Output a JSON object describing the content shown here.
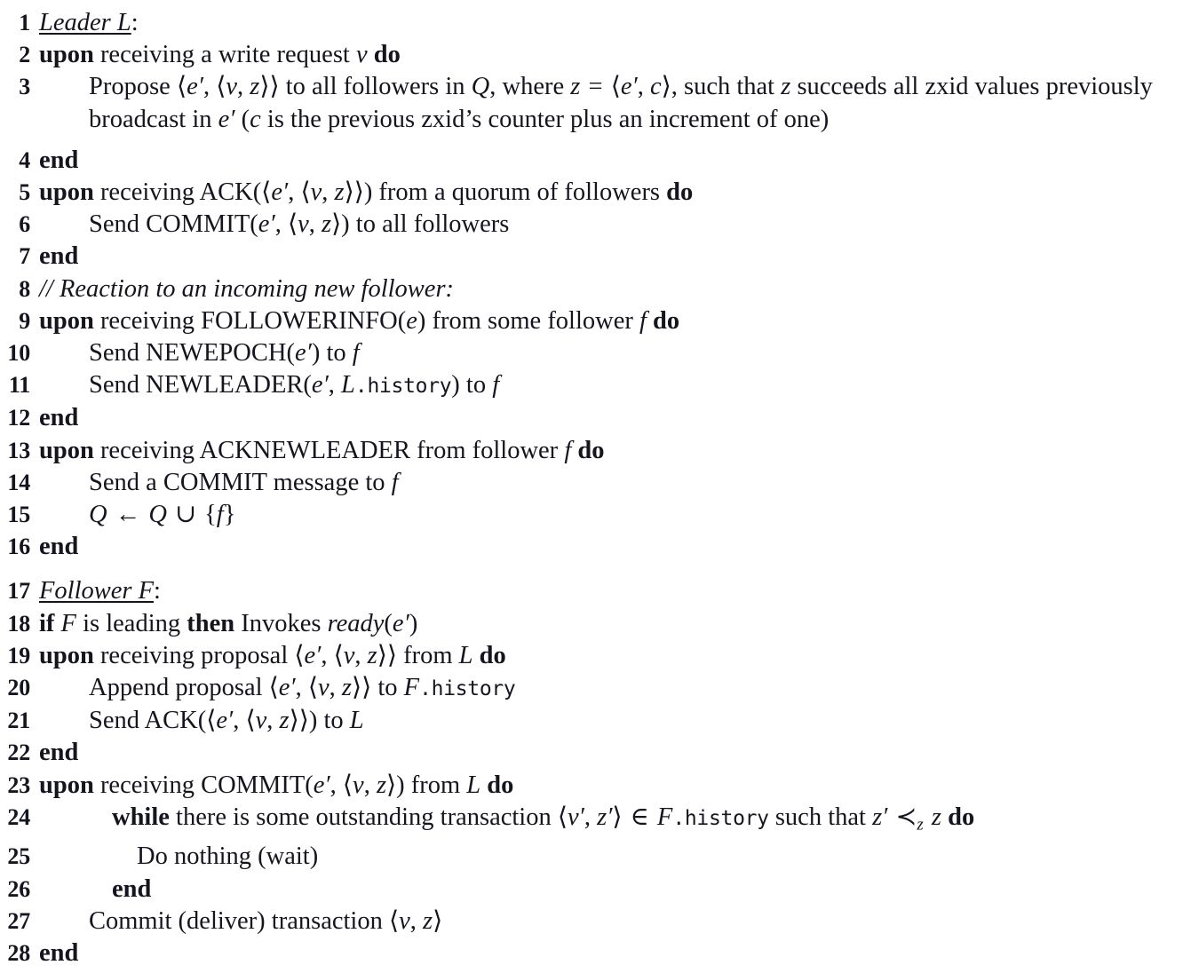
{
  "document": {
    "type": "algorithm-pseudocode",
    "title": "Zab broadcast phase pseudocode (Leader L and Follower F)",
    "font_note": "LaTeX Computer Modern style serif",
    "text_color": "#15151f",
    "background_color": "#ffffff"
  },
  "lines": [
    {
      "n": "1",
      "indent": 0,
      "html": "<span class=\"mi ul\">Leader L</span>:"
    },
    {
      "n": "2",
      "indent": 0,
      "html": "<span class=\"kw\">upon</span> receiving a write request <span class=\"mi\">v</span> <span class=\"kw\">do</span>"
    },
    {
      "n": "3",
      "indent": 1,
      "html": "Propose &#10216;<span class=\"mi\">e</span><span class=\"prime\">&#8242;</span>, &#10216;<span class=\"mi\">v</span>, <span class=\"mi\">z</span>&#10217;&#10217; to all followers in <span class=\"mi\">Q</span>, where <span class=\"mi\">z</span> <span class=\"op\">=</span> &#10216;<span class=\"mi\">e</span><span class=\"prime\">&#8242;</span>, <span class=\"mi\">c</span>&#10217;, such that <span class=\"mi\">z</span> succeeds all zxid values previously broadcast in <span class=\"mi\">e</span><span class=\"prime\">&#8242;</span> (<span class=\"mi\">c</span> is the previous zxid&#8217;s counter plus an increment of one)"
    },
    {
      "n": "4",
      "indent": 0,
      "html": "<span class=\"kw\">end</span>"
    },
    {
      "n": "5",
      "indent": 0,
      "html": "<span class=\"kw\">upon</span> receiving ACK(&#10216;<span class=\"mi\">e</span><span class=\"prime\">&#8242;</span>, &#10216;<span class=\"mi\">v</span>, <span class=\"mi\">z</span>&#10217;&#10217;) from a quorum of followers <span class=\"kw\">do</span>"
    },
    {
      "n": "6",
      "indent": 1,
      "html": "Send COMMIT(<span class=\"mi\">e</span><span class=\"prime\">&#8242;</span>, &#10216;<span class=\"mi\">v</span>, <span class=\"mi\">z</span>&#10217;) to all followers"
    },
    {
      "n": "7",
      "indent": 0,
      "html": "<span class=\"kw\">end</span>"
    },
    {
      "n": "8",
      "indent": 0,
      "html": "<span class=\"cmt\">// Reaction to an incoming new follower:</span>"
    },
    {
      "n": "9",
      "indent": 0,
      "html": "<span class=\"kw\">upon</span> receiving FOLLOWERINFO(<span class=\"mi\">e</span>) from some follower <span class=\"mi\">f</span> <span class=\"kw\">do</span>"
    },
    {
      "n": "10",
      "indent": 1,
      "html": "Send NEWEPOCH(<span class=\"mi\">e</span><span class=\"prime\">&#8242;</span>) to <span class=\"mi\">f</span>"
    },
    {
      "n": "11",
      "indent": 1,
      "html": "Send NEWLEADER(<span class=\"mi\">e</span><span class=\"prime\">&#8242;</span>, <span class=\"mi\">L</span><span class=\"tt\">.history</span>) to <span class=\"mi\">f</span>"
    },
    {
      "n": "12",
      "indent": 0,
      "html": "<span class=\"kw\">end</span>"
    },
    {
      "n": "13",
      "indent": 0,
      "html": "<span class=\"kw\">upon</span> receiving ACKNEWLEADER from follower <span class=\"mi\">f</span> <span class=\"kw\">do</span>"
    },
    {
      "n": "14",
      "indent": 1,
      "html": "Send a COMMIT message to <span class=\"mi\">f</span>"
    },
    {
      "n": "15",
      "indent": 1,
      "html": "<span class=\"mi\">Q</span> <span class=\"op\">&#8592;</span> <span class=\"mi\">Q</span> <span class=\"op\">&#8746;</span> {<span class=\"mi\">f</span>}"
    },
    {
      "n": "16",
      "indent": 0,
      "html": "<span class=\"kw\">end</span>"
    },
    {
      "n": "17",
      "indent": 0,
      "gap_before": true,
      "html": "<span class=\"mi ul\">Follower F</span>:"
    },
    {
      "n": "18",
      "indent": 0,
      "html": "<span class=\"kw\">if</span> <span class=\"mi\">F</span> is leading <span class=\"kw\">then</span> Invokes <span class=\"mi\">ready</span>(<span class=\"mi\">e</span><span class=\"prime\">&#8242;</span>)"
    },
    {
      "n": "19",
      "indent": 0,
      "html": "<span class=\"kw\">upon</span> receiving proposal &#10216;<span class=\"mi\">e</span><span class=\"prime\">&#8242;</span>, &#10216;<span class=\"mi\">v</span>, <span class=\"mi\">z</span>&#10217;&#10217; from <span class=\"mi\">L</span> <span class=\"kw\">do</span>"
    },
    {
      "n": "20",
      "indent": 1,
      "html": "Append proposal &#10216;<span class=\"mi\">e</span><span class=\"prime\">&#8242;</span>, &#10216;<span class=\"mi\">v</span>, <span class=\"mi\">z</span>&#10217;&#10217; to <span class=\"mi\">F</span><span class=\"tt\">.history</span>"
    },
    {
      "n": "21",
      "indent": 1,
      "html": "Send ACK(&#10216;<span class=\"mi\">e</span><span class=\"prime\">&#8242;</span>, &#10216;<span class=\"mi\">v</span>, <span class=\"mi\">z</span>&#10217;&#10217;) to <span class=\"mi\">L</span>"
    },
    {
      "n": "22",
      "indent": 0,
      "html": "<span class=\"kw\">end</span>"
    },
    {
      "n": "23",
      "indent": 0,
      "html": "<span class=\"kw\">upon</span> receiving COMMIT(<span class=\"mi\">e</span><span class=\"prime\">&#8242;</span>, &#10216;<span class=\"mi\">v</span>, <span class=\"mi\">z</span>&#10217;) from <span class=\"mi\">L</span> <span class=\"kw\">do</span>"
    },
    {
      "n": "24",
      "indent": 2,
      "html": "<span class=\"kw\">while</span> there is some outstanding transaction &#10216;<span class=\"mi\">v</span><span class=\"prime\">&#8242;</span>, <span class=\"mi\">z</span><span class=\"prime\">&#8242;</span>&#10217; <span class=\"op\">&#8712;</span> <span class=\"mi\">F</span><span class=\"tt\">.history</span> such that <span class=\"mi\">z</span><span class=\"prime\">&#8242;</span> <span class=\"op\">&#8826;<span class=\"sub\">z</span></span> <span class=\"mi\">z</span> <span class=\"kw\">do</span>"
    },
    {
      "n": "25",
      "indent": 3,
      "html": "Do nothing (wait)"
    },
    {
      "n": "26",
      "indent": 2,
      "html": "<span class=\"kw\">end</span>"
    },
    {
      "n": "27",
      "indent": 1,
      "html": "Commit (deliver) transaction &#10216;<span class=\"mi\">v</span>, <span class=\"mi\">z</span>&#10217;"
    },
    {
      "n": "28",
      "indent": 0,
      "html": "<span class=\"kw\">end</span>"
    }
  ],
  "plain_text_lines": [
    "1  Leader L:",
    "2  upon receiving a write request v do",
    "3      Propose ⟨e′,⟨v,z⟩⟩ to all followers in Q, where z = ⟨e′,c⟩, such that z succeeds all zxid values previously broadcast in e′ (c is the previous zxid's counter plus an increment of one)",
    "4  end",
    "5  upon receiving ACK(⟨e′,⟨v,z⟩⟩) from a quorum of followers do",
    "6      Send COMMIT(e′,⟨v,z⟩) to all followers",
    "7  end",
    "8  // Reaction to an incoming new follower:",
    "9  upon receiving FOLLOWERINFO(e) from some follower f do",
    "10     Send NEWEPOCH(e′) to f",
    "11     Send NEWLEADER(e′, L.history) to f",
    "12 end",
    "13 upon receiving ACKNEWLEADER from follower f do",
    "14     Send a COMMIT message to f",
    "15     Q ← Q ∪ {f}",
    "16 end",
    "17 Follower F:",
    "18 if F is leading then Invokes ready(e′)",
    "19 upon receiving proposal ⟨e′,⟨v,z⟩⟩ from L do",
    "20     Append proposal ⟨e′,⟨v,z⟩⟩ to F.history",
    "21     Send ACK(⟨e′,⟨v,z⟩⟩) to L",
    "22 end",
    "23 upon receiving COMMIT(e′,⟨v,z⟩) from L do",
    "24     while there is some outstanding transaction ⟨v′,z′⟩ ∈ F.history such that z′ ≺z z do",
    "25         Do nothing (wait)",
    "26     end",
    "27     Commit (deliver) transaction ⟨v,z⟩",
    "28 end"
  ]
}
